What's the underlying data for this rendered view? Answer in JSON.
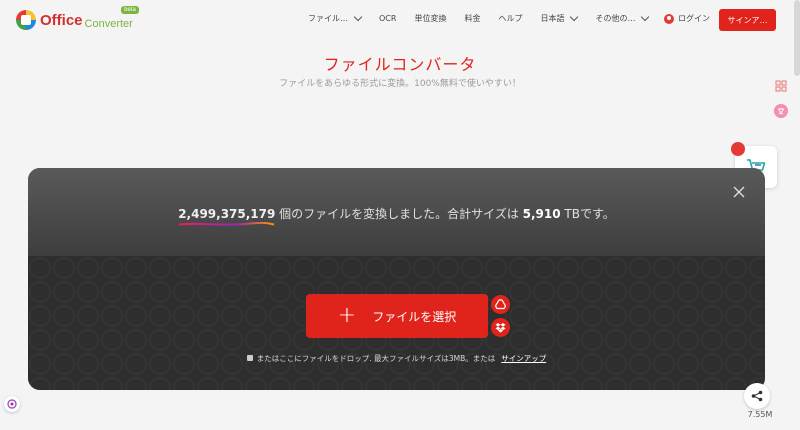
{
  "header": {
    "logo": {
      "office": "Office",
      "converter": "Converter",
      "badge": "beta"
    },
    "nav": [
      {
        "label": "ファイル…",
        "dropdown": true
      },
      {
        "label": "OCR",
        "dropdown": false
      },
      {
        "label": "単位変換",
        "dropdown": false
      },
      {
        "label": "料金",
        "dropdown": false
      },
      {
        "label": "ヘルプ",
        "dropdown": false
      },
      {
        "label": "日本語",
        "dropdown": true
      },
      {
        "label": "その他の…",
        "dropdown": true
      }
    ],
    "login_label": "ログイン",
    "signup_label": "サインア…"
  },
  "hero": {
    "title": "ファイルコンバータ",
    "subtitle": "ファイルをあらゆる形式に変換。100%無料で使いやすい！"
  },
  "stats": {
    "count": "2,499,375,179",
    "text_mid": " 個のファイルを変換しました。合計サイズは ",
    "size": "5,910",
    "text_end": " TBです。"
  },
  "upload": {
    "plus": "+",
    "select_label": "ファイルを選択",
    "drop_note": "またはここにファイルをドロップ. 最大ファイルサイズは3MB。または",
    "signup_link": "サインアップ"
  },
  "cart": {
    "badge": "👍"
  },
  "share": {
    "count": "7.55M"
  },
  "colors": {
    "accent": "#e0241b",
    "panel": "#2d2d2d"
  }
}
